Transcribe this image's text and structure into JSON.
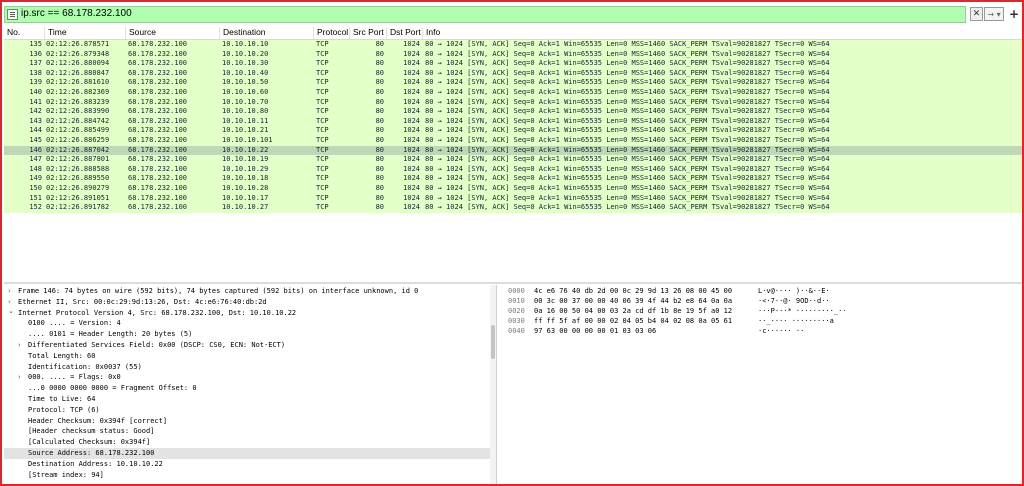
{
  "filter": {
    "expression": "ip.src == 68.178.232.100",
    "clear_glyph": "✕",
    "apply_glyph": "→ ▾",
    "add_glyph": "+"
  },
  "columns": [
    "No.",
    "Time",
    "Source",
    "Destination",
    "Protocol",
    "Src Port",
    "Dst Port",
    "Info"
  ],
  "packets": [
    {
      "no": "135",
      "time": "02:12:26.878571",
      "src": "68.178.232.100",
      "dst": "10.10.10.10",
      "proto": "TCP",
      "sport": "80",
      "dport": "1024",
      "info": "80 → 1024 [SYN, ACK] Seq=0 Ack=1 Win=65535 Len=0 MSS=1460 SACK_PERM TSval=90281827 TSecr=0 WS=64"
    },
    {
      "no": "136",
      "time": "02:12:26.879348",
      "src": "68.178.232.100",
      "dst": "10.10.10.20",
      "proto": "TCP",
      "sport": "80",
      "dport": "1024",
      "info": "80 → 1024 [SYN, ACK] Seq=0 Ack=1 Win=65535 Len=0 MSS=1460 SACK_PERM TSval=90281827 TSecr=0 WS=64"
    },
    {
      "no": "137",
      "time": "02:12:26.880094",
      "src": "68.178.232.100",
      "dst": "10.10.10.30",
      "proto": "TCP",
      "sport": "80",
      "dport": "1024",
      "info": "80 → 1024 [SYN, ACK] Seq=0 Ack=1 Win=65535 Len=0 MSS=1460 SACK_PERM TSval=90281827 TSecr=0 WS=64"
    },
    {
      "no": "138",
      "time": "02:12:26.880847",
      "src": "68.178.232.100",
      "dst": "10.10.10.40",
      "proto": "TCP",
      "sport": "80",
      "dport": "1024",
      "info": "80 → 1024 [SYN, ACK] Seq=0 Ack=1 Win=65535 Len=0 MSS=1460 SACK_PERM TSval=90281827 TSecr=0 WS=64"
    },
    {
      "no": "139",
      "time": "02:12:26.881610",
      "src": "68.178.232.100",
      "dst": "10.10.10.50",
      "proto": "TCP",
      "sport": "80",
      "dport": "1024",
      "info": "80 → 1024 [SYN, ACK] Seq=0 Ack=1 Win=65535 Len=0 MSS=1460 SACK_PERM TSval=90281827 TSecr=0 WS=64"
    },
    {
      "no": "140",
      "time": "02:12:26.882369",
      "src": "68.178.232.100",
      "dst": "10.10.10.60",
      "proto": "TCP",
      "sport": "80",
      "dport": "1024",
      "info": "80 → 1024 [SYN, ACK] Seq=0 Ack=1 Win=65535 Len=0 MSS=1460 SACK_PERM TSval=90281827 TSecr=0 WS=64"
    },
    {
      "no": "141",
      "time": "02:12:26.883239",
      "src": "68.178.232.100",
      "dst": "10.10.10.70",
      "proto": "TCP",
      "sport": "80",
      "dport": "1024",
      "info": "80 → 1024 [SYN, ACK] Seq=0 Ack=1 Win=65535 Len=0 MSS=1460 SACK_PERM TSval=90281827 TSecr=0 WS=64"
    },
    {
      "no": "142",
      "time": "02:12:26.883990",
      "src": "68.178.232.100",
      "dst": "10.10.10.80",
      "proto": "TCP",
      "sport": "80",
      "dport": "1024",
      "info": "80 → 1024 [SYN, ACK] Seq=0 Ack=1 Win=65535 Len=0 MSS=1460 SACK_PERM TSval=90281827 TSecr=0 WS=64"
    },
    {
      "no": "143",
      "time": "02:12:26.884742",
      "src": "68.178.232.100",
      "dst": "10.10.10.11",
      "proto": "TCP",
      "sport": "80",
      "dport": "1024",
      "info": "80 → 1024 [SYN, ACK] Seq=0 Ack=1 Win=65535 Len=0 MSS=1460 SACK_PERM TSval=90281827 TSecr=0 WS=64"
    },
    {
      "no": "144",
      "time": "02:12:26.885499",
      "src": "68.178.232.100",
      "dst": "10.10.10.21",
      "proto": "TCP",
      "sport": "80",
      "dport": "1024",
      "info": "80 → 1024 [SYN, ACK] Seq=0 Ack=1 Win=65535 Len=0 MSS=1460 SACK_PERM TSval=90281827 TSecr=0 WS=64"
    },
    {
      "no": "145",
      "time": "02:12:26.886259",
      "src": "68.178.232.100",
      "dst": "10.10.10.101",
      "proto": "TCP",
      "sport": "80",
      "dport": "1024",
      "info": "80 → 1024 [SYN, ACK] Seq=0 Ack=1 Win=65535 Len=0 MSS=1460 SACK_PERM TSval=90281827 TSecr=0 WS=64"
    },
    {
      "no": "146",
      "time": "02:12:26.887042",
      "src": "68.178.232.100",
      "dst": "10.10.10.22",
      "proto": "TCP",
      "sport": "80",
      "dport": "1024",
      "info": "80 → 1024 [SYN, ACK] Seq=0 Ack=1 Win=65535 Len=0 MSS=1460 SACK_PERM TSval=90281827 TSecr=0 WS=64",
      "selected": true
    },
    {
      "no": "147",
      "time": "02:12:26.887801",
      "src": "68.178.232.100",
      "dst": "10.10.10.19",
      "proto": "TCP",
      "sport": "80",
      "dport": "1024",
      "info": "80 → 1024 [SYN, ACK] Seq=0 Ack=1 Win=65535 Len=0 MSS=1460 SACK_PERM TSval=90281827 TSecr=0 WS=64"
    },
    {
      "no": "148",
      "time": "02:12:26.888588",
      "src": "68.178.232.100",
      "dst": "10.10.10.29",
      "proto": "TCP",
      "sport": "80",
      "dport": "1024",
      "info": "80 → 1024 [SYN, ACK] Seq=0 Ack=1 Win=65535 Len=0 MSS=1460 SACK_PERM TSval=90281827 TSecr=0 WS=64"
    },
    {
      "no": "149",
      "time": "02:12:26.889550",
      "src": "68.178.232.100",
      "dst": "10.10.10.18",
      "proto": "TCP",
      "sport": "80",
      "dport": "1024",
      "info": "80 → 1024 [SYN, ACK] Seq=0 Ack=1 Win=65535 Len=0 MSS=1460 SACK_PERM TSval=90281827 TSecr=0 WS=64"
    },
    {
      "no": "150",
      "time": "02:12:26.890279",
      "src": "68.178.232.100",
      "dst": "10.10.10.28",
      "proto": "TCP",
      "sport": "80",
      "dport": "1024",
      "info": "80 → 1024 [SYN, ACK] Seq=0 Ack=1 Win=65535 Len=0 MSS=1460 SACK_PERM TSval=90281827 TSecr=0 WS=64"
    },
    {
      "no": "151",
      "time": "02:12:26.891051",
      "src": "68.178.232.100",
      "dst": "10.10.10.17",
      "proto": "TCP",
      "sport": "80",
      "dport": "1024",
      "info": "80 → 1024 [SYN, ACK] Seq=0 Ack=1 Win=65535 Len=0 MSS=1460 SACK_PERM TSval=90281827 TSecr=0 WS=64"
    },
    {
      "no": "152",
      "time": "02:12:26.891782",
      "src": "68.178.232.100",
      "dst": "10.10.10.27",
      "proto": "TCP",
      "sport": "80",
      "dport": "1024",
      "info": "80 → 1024 [SYN, ACK] Seq=0 Ack=1 Win=65535 Len=0 MSS=1460 SACK_PERM TSval=90281827 TSecr=0 WS=64"
    }
  ],
  "details": [
    {
      "indent": 0,
      "arrow": "collapsed",
      "text": "Frame 146: 74 bytes on wire (592 bits), 74 bytes captured (592 bits) on interface unknown, id 0"
    },
    {
      "indent": 0,
      "arrow": "collapsed",
      "text": "Ethernet II, Src: 00:0c:29:9d:13:26, Dst: 4c:e6:76:40:db:2d"
    },
    {
      "indent": 0,
      "arrow": "expanded",
      "text": "Internet Protocol Version 4, Src: 68.178.232.100, Dst: 10.10.10.22"
    },
    {
      "indent": 1,
      "arrow": "",
      "text": "0100 .... = Version: 4"
    },
    {
      "indent": 1,
      "arrow": "",
      "text": ".... 0101 = Header Length: 20 bytes (5)"
    },
    {
      "indent": 1,
      "arrow": "collapsed",
      "text": "Differentiated Services Field: 0x00 (DSCP: CS0, ECN: Not-ECT)"
    },
    {
      "indent": 1,
      "arrow": "",
      "text": "Total Length: 60"
    },
    {
      "indent": 1,
      "arrow": "",
      "text": "Identification: 0x0037 (55)"
    },
    {
      "indent": 1,
      "arrow": "collapsed",
      "text": "000. .... = Flags: 0x0"
    },
    {
      "indent": 1,
      "arrow": "",
      "text": "...0 0000 0000 0000 = Fragment Offset: 0"
    },
    {
      "indent": 1,
      "arrow": "",
      "text": "Time to Live: 64"
    },
    {
      "indent": 1,
      "arrow": "",
      "text": "Protocol: TCP (6)"
    },
    {
      "indent": 1,
      "arrow": "",
      "text": "Header Checksum: 0x394f [correct]"
    },
    {
      "indent": 1,
      "arrow": "",
      "text": "[Header checksum status: Good]"
    },
    {
      "indent": 1,
      "arrow": "",
      "text": "[Calculated Checksum: 0x394f]"
    },
    {
      "indent": 1,
      "arrow": "",
      "text": "Source Address: 68.178.232.100",
      "highlight": true
    },
    {
      "indent": 1,
      "arrow": "",
      "text": "Destination Address: 10.10.10.22"
    },
    {
      "indent": 1,
      "arrow": "",
      "text": "[Stream index: 94]"
    }
  ],
  "bytes": [
    {
      "offset": "0000",
      "hex": "4c e6 76 40 db 2d 00 0c  29 9d 13 26 08 00 45 00",
      "ascii": "L·v@·-··  )··&··E·"
    },
    {
      "offset": "0010",
      "hex": "00 3c 00 37 00 00 40 06  39 4f 44 b2 e8 64 0a 0a",
      "ascii": "·<·7··@· 9OD··d··"
    },
    {
      "offset": "0020",
      "hex": "0a 16 00 50 04 00 03 2a  cd df 1b 8e 19 5f a0 12",
      "ascii": "···P···*  ·········_··"
    },
    {
      "offset": "0030",
      "hex": "ff ff 5f af 00 00 02 04  05 b4 04 02 08 0a 05 61",
      "ascii": "··_····  ·········a"
    },
    {
      "offset": "0040",
      "hex": "97 63 00 00 00 00 01 03  03 06",
      "ascii": "·c······ ··"
    }
  ]
}
